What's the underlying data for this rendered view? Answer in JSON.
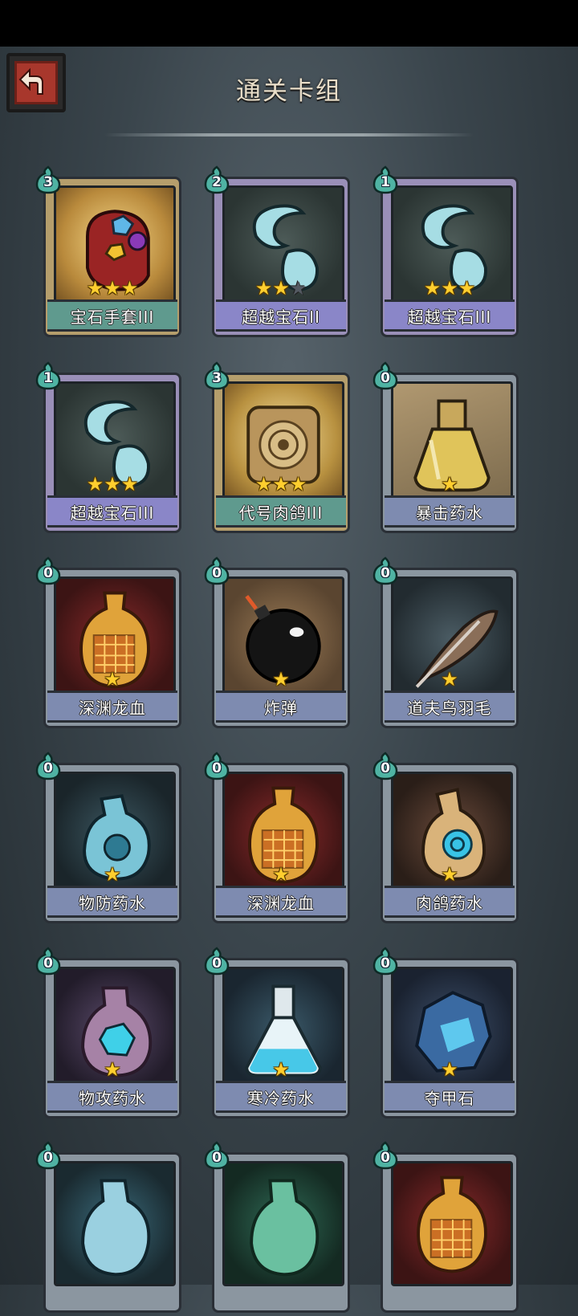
{
  "header": {
    "title": "通关卡组",
    "back_icon": "back-arrow-icon"
  },
  "colors": {
    "cost_badge": "#4fb3a3",
    "star": "#ffce2e",
    "back_button": "#a8372c"
  },
  "cards": [
    {
      "name": "宝石手套III",
      "cost": "3",
      "stars": 3,
      "max_stars": 3,
      "rarity": "gold",
      "icon": "gem-gauntlet-icon"
    },
    {
      "name": "超越宝石II",
      "cost": "2",
      "stars": 2,
      "max_stars": 3,
      "rarity": "purple",
      "icon": "crystal-gem-icon"
    },
    {
      "name": "超越宝石III",
      "cost": "1",
      "stars": 3,
      "max_stars": 3,
      "rarity": "purple",
      "icon": "crystal-gem-icon"
    },
    {
      "name": "超越宝石III",
      "cost": "1",
      "stars": 3,
      "max_stars": 3,
      "rarity": "purple",
      "icon": "crystal-gem-icon"
    },
    {
      "name": "代号肉鸽III",
      "cost": "3",
      "stars": 3,
      "max_stars": 3,
      "rarity": "gold",
      "icon": "rogue-device-icon"
    },
    {
      "name": "暴击药水",
      "cost": "0",
      "stars": 1,
      "max_stars": 1,
      "rarity": "normal",
      "icon": "crit-potion-icon"
    },
    {
      "name": "深渊龙血",
      "cost": "0",
      "stars": 1,
      "max_stars": 1,
      "rarity": "normal",
      "icon": "dragon-blood-icon"
    },
    {
      "name": "炸弹",
      "cost": "0",
      "stars": 1,
      "max_stars": 1,
      "rarity": "normal",
      "icon": "bomb-icon"
    },
    {
      "name": "道夫鸟羽毛",
      "cost": "0",
      "stars": 1,
      "max_stars": 1,
      "rarity": "normal",
      "icon": "feather-icon"
    },
    {
      "name": "物防药水",
      "cost": "0",
      "stars": 1,
      "max_stars": 1,
      "rarity": "normal",
      "icon": "defense-potion-icon"
    },
    {
      "name": "深渊龙血",
      "cost": "0",
      "stars": 1,
      "max_stars": 1,
      "rarity": "normal",
      "icon": "dragon-blood-icon"
    },
    {
      "name": "肉鸽药水",
      "cost": "0",
      "stars": 1,
      "max_stars": 1,
      "rarity": "normal",
      "icon": "rogue-potion-icon"
    },
    {
      "name": "物攻药水",
      "cost": "0",
      "stars": 1,
      "max_stars": 1,
      "rarity": "normal",
      "icon": "attack-potion-icon"
    },
    {
      "name": "寒冷药水",
      "cost": "0",
      "stars": 1,
      "max_stars": 1,
      "rarity": "normal",
      "icon": "cold-potion-icon"
    },
    {
      "name": "夺甲石",
      "cost": "0",
      "stars": 1,
      "max_stars": 1,
      "rarity": "normal",
      "icon": "armor-stone-icon"
    },
    {
      "name": "",
      "cost": "0",
      "stars": 0,
      "max_stars": 0,
      "rarity": "normal",
      "icon": "blue-potion-icon"
    },
    {
      "name": "",
      "cost": "0",
      "stars": 0,
      "max_stars": 0,
      "rarity": "normal",
      "icon": "green-potion-icon"
    },
    {
      "name": "",
      "cost": "0",
      "stars": 0,
      "max_stars": 0,
      "rarity": "normal",
      "icon": "dragon-blood-icon"
    }
  ]
}
